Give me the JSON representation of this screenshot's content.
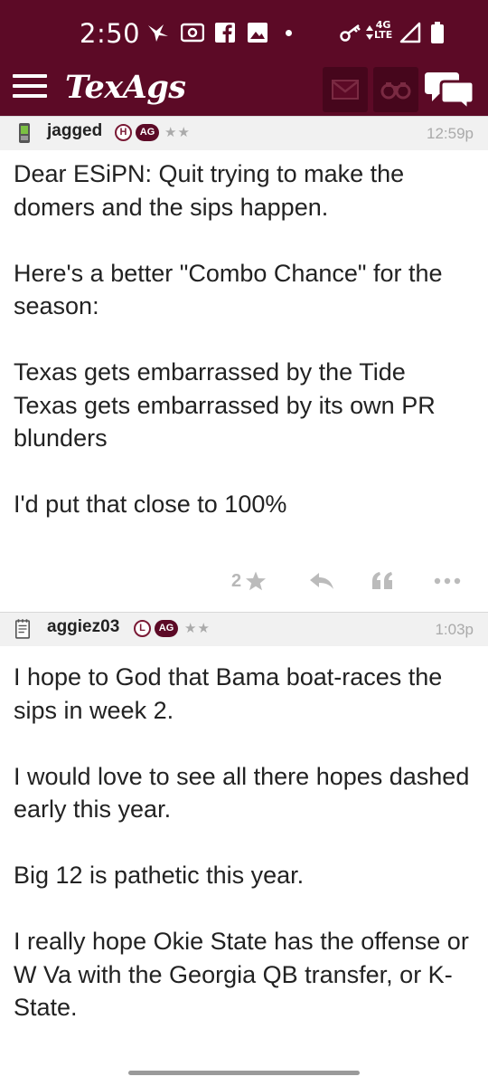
{
  "status_bar": {
    "time": "2:50",
    "network_label_top": "4G",
    "network_label_bottom": "LTE",
    "icons": [
      "bird-app-icon",
      "radio-icon",
      "facebook-icon",
      "image-icon",
      "key-icon",
      "data-arrows-icon",
      "signal-icon",
      "battery-icon"
    ]
  },
  "app_bar": {
    "logo": "TexAgs",
    "icons": [
      "menu-icon",
      "mail-icon",
      "binoculars-icon",
      "forum-icon"
    ],
    "colors": {
      "primary": "#5c0a26",
      "button_bg": "#46061c"
    }
  },
  "posts": [
    {
      "username": "jagged",
      "badge_letter": "H",
      "badge_tag": "AG",
      "stars": "★★",
      "time": "12:59p",
      "device_icon": "phone-icon",
      "paragraphs": [
        "Dear ESiPN: Quit trying to make the domers and the sips happen.",
        "Here's a better \"Combo Chance\" for the season:",
        "Texas gets embarrassed by the Tide\nTexas gets embarrassed by its own PR blunders",
        "I'd put that close to 100%"
      ],
      "rating_count": "2"
    },
    {
      "username": "aggiez03",
      "badge_letter": "L",
      "badge_tag": "AG",
      "stars": "★★",
      "time": "1:03p",
      "device_icon": "notepad-icon",
      "paragraphs": [
        "I hope to God that Bama boat-races the sips in week 2.",
        "I would love to see all there hopes dashed early this year.",
        "Big 12 is pathetic this year.",
        "I really hope Okie State has the offense or W Va with the Georgia QB transfer, or K-State."
      ]
    }
  ]
}
